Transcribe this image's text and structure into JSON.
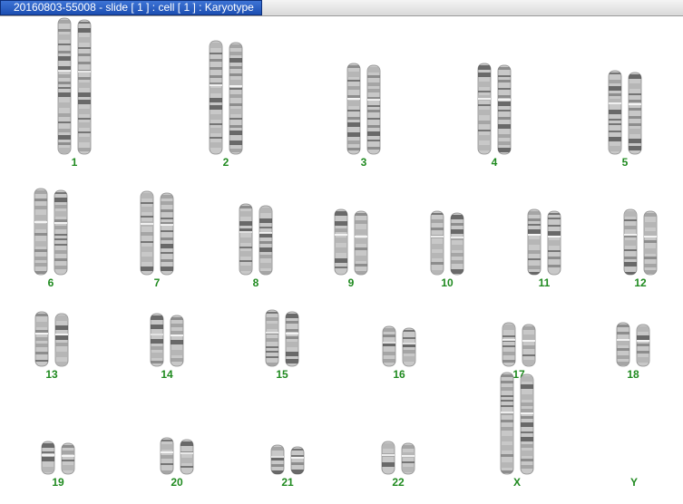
{
  "window": {
    "title": "20160803-55008 - slide [ 1 ] : cell [ 1 ] : Karyotype"
  },
  "colors": {
    "label": "#1f8a1f",
    "title_bar": "#2a5fc4",
    "chromosome_stain": "#6e6e6e"
  },
  "karyotype": {
    "labels": [
      "1",
      "2",
      "3",
      "4",
      "5",
      "6",
      "7",
      "8",
      "9",
      "10",
      "11",
      "12",
      "13",
      "14",
      "15",
      "16",
      "17",
      "18",
      "19",
      "20",
      "21",
      "22",
      "X",
      "Y"
    ],
    "pairs_present": 23,
    "y_present": false
  }
}
